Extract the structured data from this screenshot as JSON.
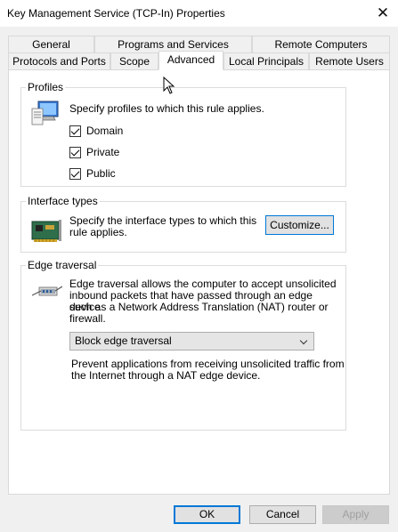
{
  "window": {
    "title": "Key Management Service (TCP-In) Properties"
  },
  "tabs": {
    "row1": [
      {
        "label": "General"
      },
      {
        "label": "Programs and Services"
      },
      {
        "label": "Remote Computers"
      }
    ],
    "row2": [
      {
        "label": "Protocols and Ports"
      },
      {
        "label": "Scope"
      },
      {
        "label": "Advanced",
        "active": true
      },
      {
        "label": "Local Principals"
      },
      {
        "label": "Remote Users"
      }
    ]
  },
  "profiles": {
    "group_label": "Profiles",
    "description": "Specify profiles to which this rule applies.",
    "options": [
      {
        "label": "Domain",
        "checked": true
      },
      {
        "label": "Private",
        "checked": true
      },
      {
        "label": "Public",
        "checked": true
      }
    ]
  },
  "interface_types": {
    "group_label": "Interface types",
    "description_line1": "Specify the interface types to which this",
    "description_line2": "rule applies.",
    "customize_label": "Customize..."
  },
  "edge_traversal": {
    "group_label": "Edge traversal",
    "description_lines": [
      "Edge traversal allows the computer to accept unsolicited",
      "inbound packets that have passed through an edge device",
      "such as a Network Address Translation (NAT) router or",
      "firewall."
    ],
    "selected_option": "Block edge traversal",
    "help_lines": [
      "Prevent applications from receiving unsolicited traffic from",
      "the Internet through a NAT edge device."
    ]
  },
  "footer": {
    "ok_label": "OK",
    "cancel_label": "Cancel",
    "apply_label": "Apply"
  }
}
